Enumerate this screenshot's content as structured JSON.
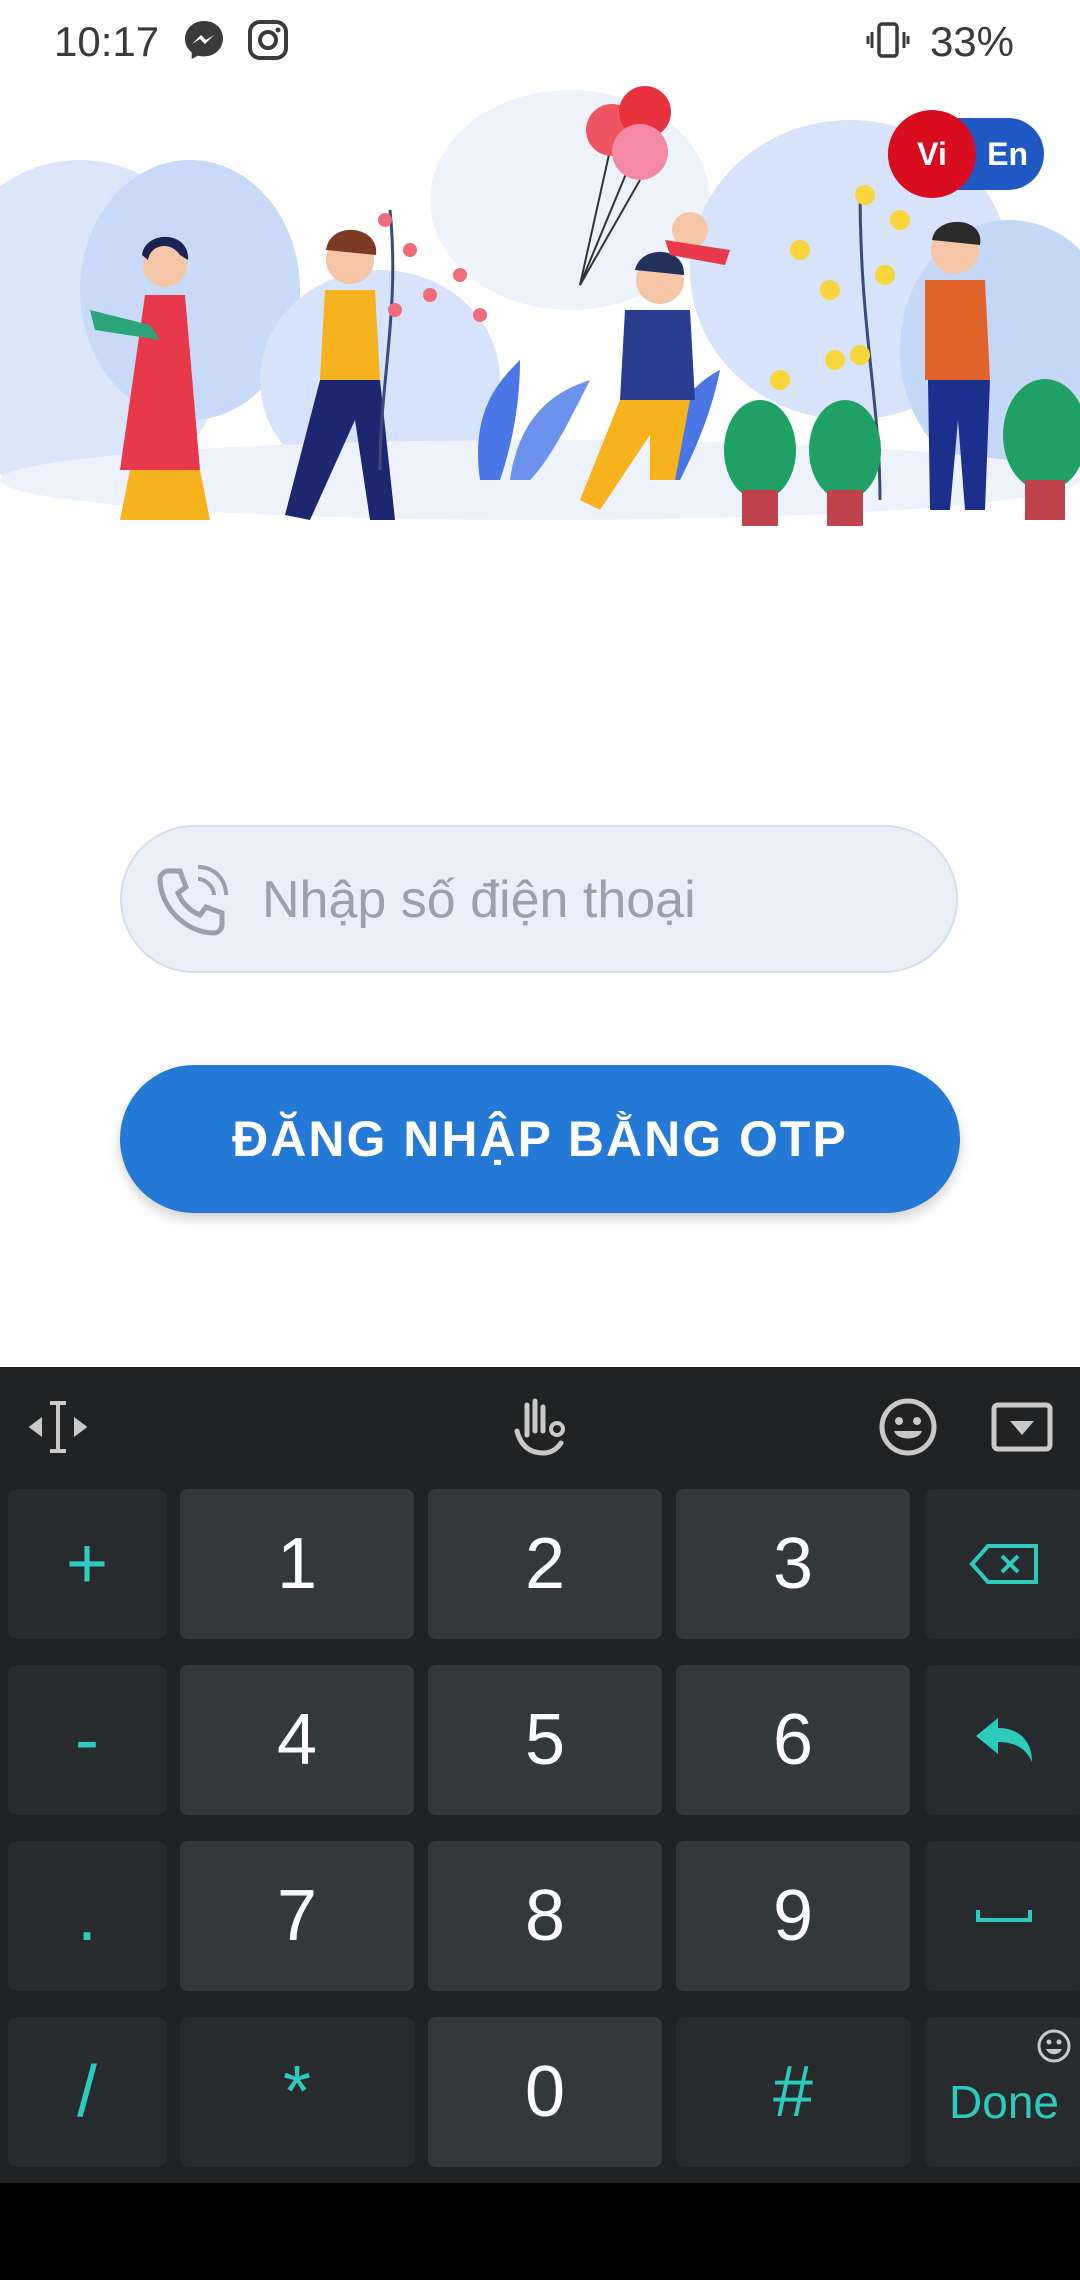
{
  "status_bar": {
    "time": "10:17",
    "notification_icons": [
      "messenger-icon",
      "instagram-icon"
    ],
    "right_icons": [
      "vibrate-icon"
    ],
    "battery": "33%"
  },
  "language": {
    "vi": "Vi",
    "en": "En",
    "selected": "Vi"
  },
  "login": {
    "phone_placeholder": "Nhập số điện thoại",
    "phone_value": "",
    "otp_button": "ĐĂNG NHẬP BẰNG OTP"
  },
  "colors": {
    "primary": "#2478d6",
    "lang_active": "#d80c1f",
    "lang_bg": "#1f57c3",
    "keyboard_bg": "#202223",
    "keyboard_accent": "#2ccbbd"
  },
  "keyboard": {
    "toolbar_icons": [
      "text-cursor-icon",
      "gesture-icon",
      "emoji-icon",
      "hide-keyboard-icon"
    ],
    "rows": [
      [
        "+",
        "1",
        "2",
        "3",
        "⌫"
      ],
      [
        "-",
        "4",
        "5",
        "6",
        "↵"
      ],
      [
        ".",
        "7",
        "8",
        "9",
        "␣"
      ],
      [
        "/",
        "*",
        "0",
        "#",
        "Done"
      ]
    ]
  }
}
